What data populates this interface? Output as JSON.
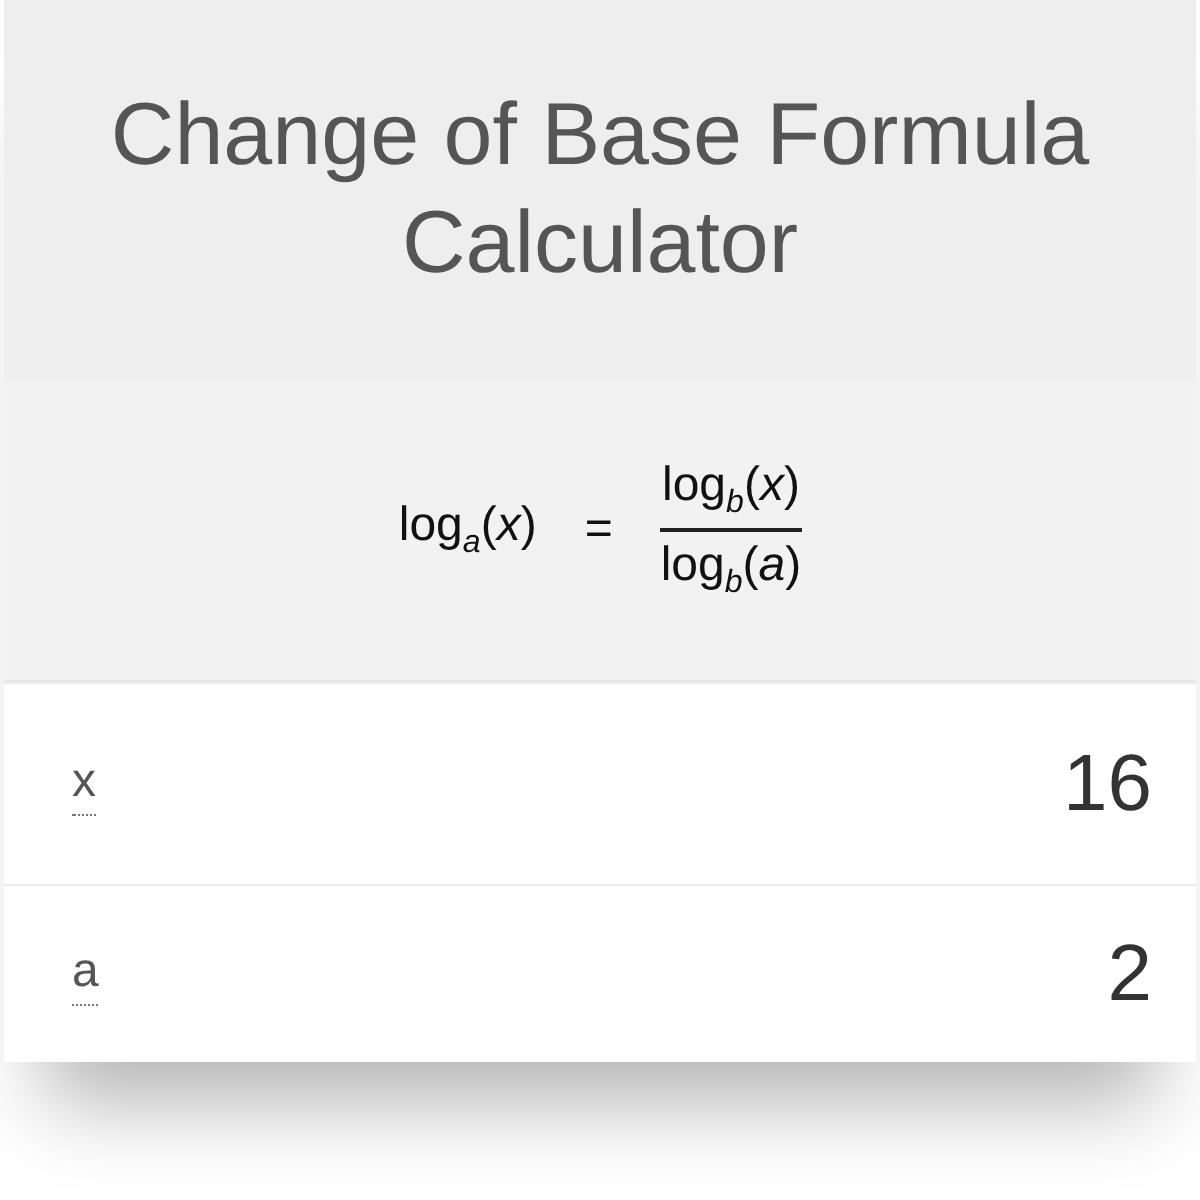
{
  "title": "Change of Base Formula Calculator",
  "formula": {
    "left": "log$_{a}$(*x*)",
    "equals": "=",
    "numerator": "log$_{b}$(*x*)",
    "denominator": "log$_{b}$(*a*)"
  },
  "fields": [
    {
      "label": "x",
      "value": "16"
    },
    {
      "label": "a",
      "value": "2"
    }
  ]
}
